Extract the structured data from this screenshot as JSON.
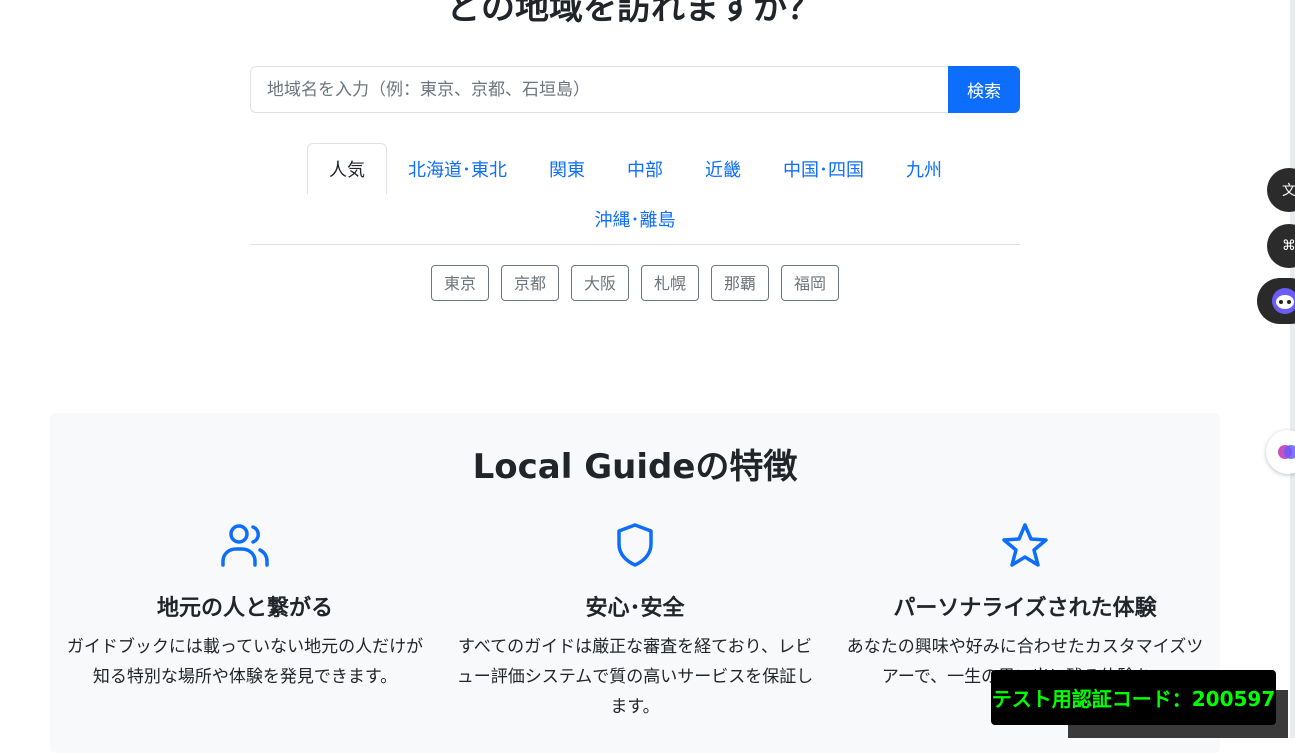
{
  "hero": {
    "title": "どの地域を訪れますか？"
  },
  "search": {
    "placeholder": "地域名を入力（例：東京、京都、石垣島）",
    "button_label": "検索"
  },
  "region_tabs": [
    {
      "label": "人気",
      "active": true
    },
    {
      "label": "北海道･東北",
      "active": false
    },
    {
      "label": "関東",
      "active": false
    },
    {
      "label": "中部",
      "active": false
    },
    {
      "label": "近畿",
      "active": false
    },
    {
      "label": "中国･四国",
      "active": false
    },
    {
      "label": "九州",
      "active": false
    },
    {
      "label": "沖縄･離島",
      "active": false
    }
  ],
  "popular_chips": [
    "東京",
    "京都",
    "大阪",
    "札幌",
    "那覇",
    "福岡"
  ],
  "features": {
    "title": "Local Guideの特徴",
    "items": [
      {
        "icon": "people-icon",
        "title": "地元の人と繋がる",
        "text": "ガイドブックには載っていない地元の人だけが知る特別な場所や体験を発見できます。"
      },
      {
        "icon": "shield-icon",
        "title": "安心･安全",
        "text": "すべてのガイドは厳正な審査を経ており、レビュー評価システムで質の高いサービスを保証します。"
      },
      {
        "icon": "star-icon",
        "title": "パーソナライズされた体験",
        "text": "あなたの興味や好みに合わせたカスタマイズツアーで、一生の思い出に残る体験を。"
      }
    ]
  },
  "overlay": {
    "test_code": "テスト用認証コード：200597"
  },
  "colors": {
    "accent": "#0d6efd",
    "section_bg": "#f8f9fa",
    "badge_text": "#00ff00"
  }
}
